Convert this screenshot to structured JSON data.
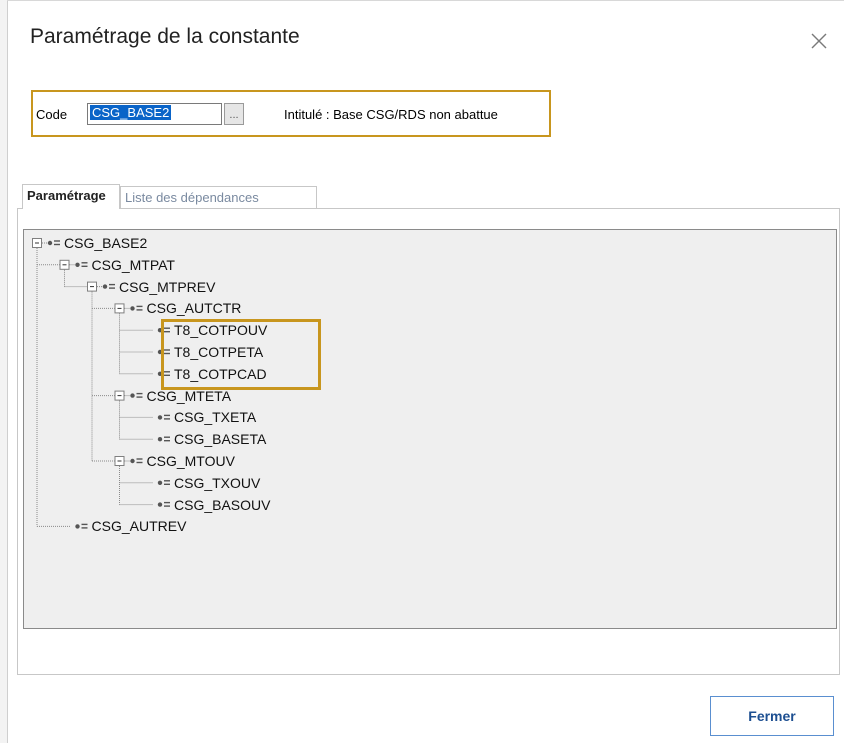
{
  "dialog": {
    "title": "Paramétrage de la constante",
    "close_icon": "close-icon"
  },
  "code": {
    "label": "Code",
    "value": "CSG_BASE2",
    "browse_label": "...",
    "intitule": "Intitulé : Base CSG/RDS non abattue"
  },
  "tabs": [
    {
      "label": "Paramétrage",
      "active": true
    },
    {
      "label": "Liste des dépendances",
      "active": false
    }
  ],
  "tree": [
    {
      "label": "CSG_BASE2",
      "depth": 0,
      "expandable": true
    },
    {
      "label": "CSG_MTPAT",
      "depth": 1,
      "expandable": true
    },
    {
      "label": "CSG_MTPREV",
      "depth": 2,
      "expandable": true
    },
    {
      "label": "CSG_AUTCTR",
      "depth": 3,
      "expandable": true
    },
    {
      "label": "T8_COTPOUV",
      "depth": 4,
      "expandable": false
    },
    {
      "label": "T8_COTPETA",
      "depth": 4,
      "expandable": false
    },
    {
      "label": "T8_COTPCAD",
      "depth": 4,
      "expandable": false
    },
    {
      "label": "CSG_MTETA",
      "depth": 3,
      "expandable": true
    },
    {
      "label": "CSG_TXETA",
      "depth": 4,
      "expandable": false
    },
    {
      "label": "CSG_BASETA",
      "depth": 4,
      "expandable": false
    },
    {
      "label": "CSG_MTOUV",
      "depth": 3,
      "expandable": true
    },
    {
      "label": "CSG_TXOUV",
      "depth": 4,
      "expandable": false
    },
    {
      "label": "CSG_BASOUV",
      "depth": 4,
      "expandable": false
    },
    {
      "label": "CSG_AUTREV",
      "depth": 1,
      "expandable": false
    }
  ],
  "footer": {
    "close_button": "Fermer"
  },
  "colors": {
    "highlight": "#c8961e",
    "selection": "#0a64c8",
    "button_text": "#1d4f91"
  }
}
